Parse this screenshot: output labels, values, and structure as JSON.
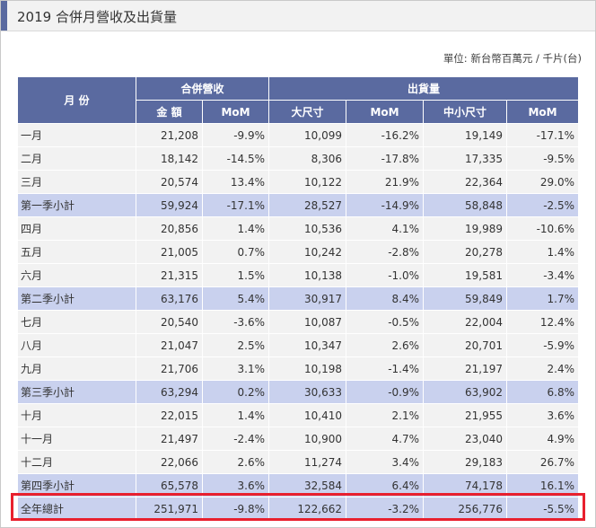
{
  "title": "2019 合併月營收及出貨量",
  "unit_note": "單位: 新台幣百萬元 / 千片(台)",
  "colors": {
    "header_bg": "#5a6aa0",
    "subtotal_bg": "#c9d1ee",
    "row_bg": "#f2f2f2",
    "highlight_border": "#e8202e"
  },
  "headers": {
    "month": "月 份",
    "revenue_group": "合併營收",
    "shipment_group": "出貨量",
    "amount": "金 額",
    "mom": "MoM",
    "large": "大尺寸",
    "small_medium": "中小尺寸"
  },
  "rows": [
    {
      "label": "一月",
      "amount": "21,208",
      "amount_mom": "-9.9%",
      "large": "10,099",
      "large_mom": "-16.2%",
      "sm": "19,149",
      "sm_mom": "-17.1%"
    },
    {
      "label": "二月",
      "amount": "18,142",
      "amount_mom": "-14.5%",
      "large": "8,306",
      "large_mom": "-17.8%",
      "sm": "17,335",
      "sm_mom": "-9.5%"
    },
    {
      "label": "三月",
      "amount": "20,574",
      "amount_mom": "13.4%",
      "large": "10,122",
      "large_mom": "21.9%",
      "sm": "22,364",
      "sm_mom": "29.0%"
    },
    {
      "label": "第一季小計",
      "amount": "59,924",
      "amount_mom": "-17.1%",
      "large": "28,527",
      "large_mom": "-14.9%",
      "sm": "58,848",
      "sm_mom": "-2.5%"
    },
    {
      "label": "四月",
      "amount": "20,856",
      "amount_mom": "1.4%",
      "large": "10,536",
      "large_mom": "4.1%",
      "sm": "19,989",
      "sm_mom": "-10.6%"
    },
    {
      "label": "五月",
      "amount": "21,005",
      "amount_mom": "0.7%",
      "large": "10,242",
      "large_mom": "-2.8%",
      "sm": "20,278",
      "sm_mom": "1.4%"
    },
    {
      "label": "六月",
      "amount": "21,315",
      "amount_mom": "1.5%",
      "large": "10,138",
      "large_mom": "-1.0%",
      "sm": "19,581",
      "sm_mom": "-3.4%"
    },
    {
      "label": "第二季小計",
      "amount": "63,176",
      "amount_mom": "5.4%",
      "large": "30,917",
      "large_mom": "8.4%",
      "sm": "59,849",
      "sm_mom": "1.7%"
    },
    {
      "label": "七月",
      "amount": "20,540",
      "amount_mom": "-3.6%",
      "large": "10,087",
      "large_mom": "-0.5%",
      "sm": "22,004",
      "sm_mom": "12.4%"
    },
    {
      "label": "八月",
      "amount": "21,047",
      "amount_mom": "2.5%",
      "large": "10,347",
      "large_mom": "2.6%",
      "sm": "20,701",
      "sm_mom": "-5.9%"
    },
    {
      "label": "九月",
      "amount": "21,706",
      "amount_mom": "3.1%",
      "large": "10,198",
      "large_mom": "-1.4%",
      "sm": "21,197",
      "sm_mom": "2.4%"
    },
    {
      "label": "第三季小計",
      "amount": "63,294",
      "amount_mom": "0.2%",
      "large": "30,633",
      "large_mom": "-0.9%",
      "sm": "63,902",
      "sm_mom": "6.8%"
    },
    {
      "label": "十月",
      "amount": "22,015",
      "amount_mom": "1.4%",
      "large": "10,410",
      "large_mom": "2.1%",
      "sm": "21,955",
      "sm_mom": "3.6%"
    },
    {
      "label": "十一月",
      "amount": "21,497",
      "amount_mom": "-2.4%",
      "large": "10,900",
      "large_mom": "4.7%",
      "sm": "23,040",
      "sm_mom": "4.9%"
    },
    {
      "label": "十二月",
      "amount": "22,066",
      "amount_mom": "2.6%",
      "large": "11,274",
      "large_mom": "3.4%",
      "sm": "29,183",
      "sm_mom": "26.7%"
    },
    {
      "label": "第四季小計",
      "amount": "65,578",
      "amount_mom": "3.6%",
      "large": "32,584",
      "large_mom": "6.4%",
      "sm": "74,178",
      "sm_mom": "16.1%"
    },
    {
      "label": "全年總計",
      "amount": "251,971",
      "amount_mom": "-9.8%",
      "large": "122,662",
      "large_mom": "-3.2%",
      "sm": "256,776",
      "sm_mom": "-5.5%"
    }
  ]
}
